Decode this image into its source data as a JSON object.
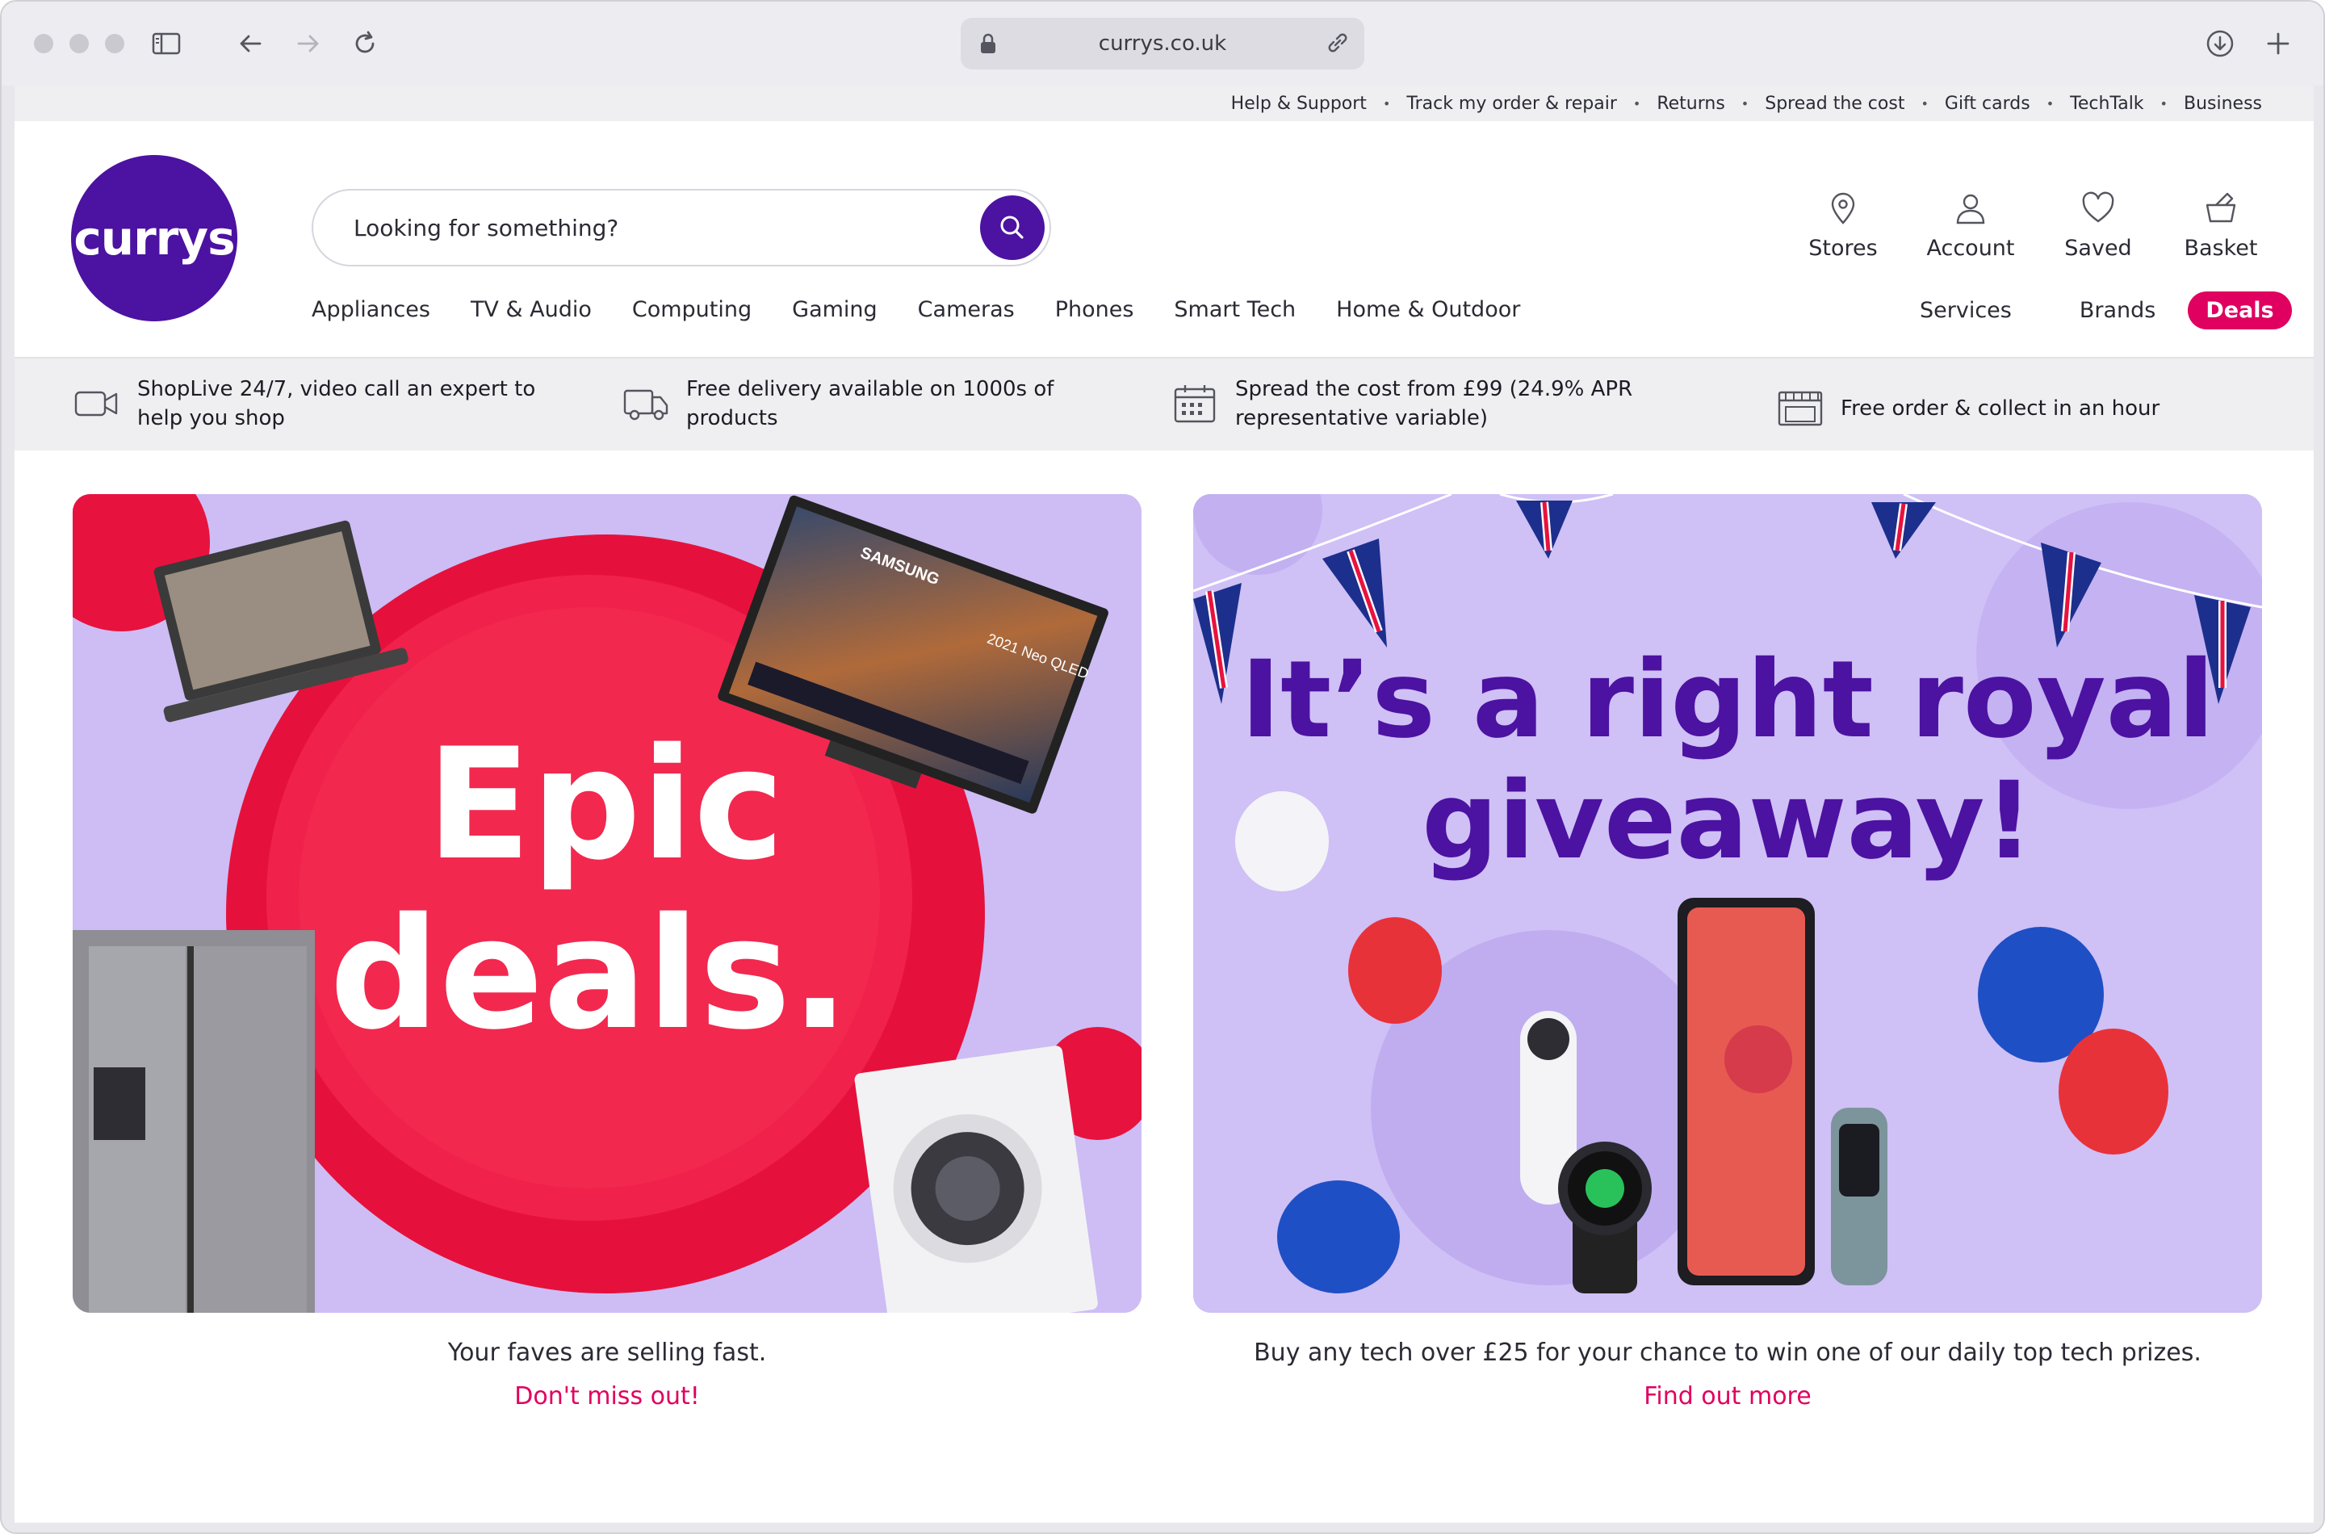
{
  "browser": {
    "url": "currys.co.uk"
  },
  "utility_nav": [
    "Help & Support",
    "Track my order & repair",
    "Returns",
    "Spread the cost",
    "Gift cards",
    "TechTalk",
    "Business"
  ],
  "logo": {
    "text": "currys"
  },
  "search": {
    "placeholder": "Looking for something?"
  },
  "account_links": [
    {
      "label": "Stores",
      "icon": "location-pin-icon"
    },
    {
      "label": "Account",
      "icon": "user-icon"
    },
    {
      "label": "Saved",
      "icon": "heart-icon"
    },
    {
      "label": "Basket",
      "icon": "basket-icon"
    }
  ],
  "main_nav": [
    "Appliances",
    "TV & Audio",
    "Computing",
    "Gaming",
    "Cameras",
    "Phones",
    "Smart Tech",
    "Home & Outdoor"
  ],
  "right_nav": {
    "services": "Services",
    "brands": "Brands",
    "deals": "Deals"
  },
  "usp": [
    {
      "line1": "ShopLive 24/7, video call an expert to",
      "line2": "help you shop",
      "icon": "video-camera-icon"
    },
    {
      "line1": "Free delivery available on 1000s of",
      "line2": "products",
      "icon": "delivery-truck-icon"
    },
    {
      "line1": "Spread the cost from £99 (24.9% APR",
      "line2": "representative variable)",
      "icon": "calendar-icon"
    },
    {
      "line1": "Free order & collect in an hour",
      "line2": "",
      "icon": "store-icon"
    }
  ],
  "banners": [
    {
      "headline1": "Epic",
      "headline2": "deals.",
      "tv_brand": "SAMSUNG",
      "tv_model": "2021 Neo QLED",
      "caption": "Your faves are selling fast.",
      "cta": "Don't miss out!"
    },
    {
      "headline1": "It’s a right royal",
      "headline2": "giveaway!",
      "caption": "Buy any tech over £25 for your chance to win one of our daily top tech prizes.",
      "cta": "Find out more"
    }
  ],
  "colors": {
    "brand_purple": "#4c12a1",
    "deals_pink": "#e0005f",
    "banner_lilac": "#cdbdf4",
    "epic_red": "#e8123e"
  }
}
